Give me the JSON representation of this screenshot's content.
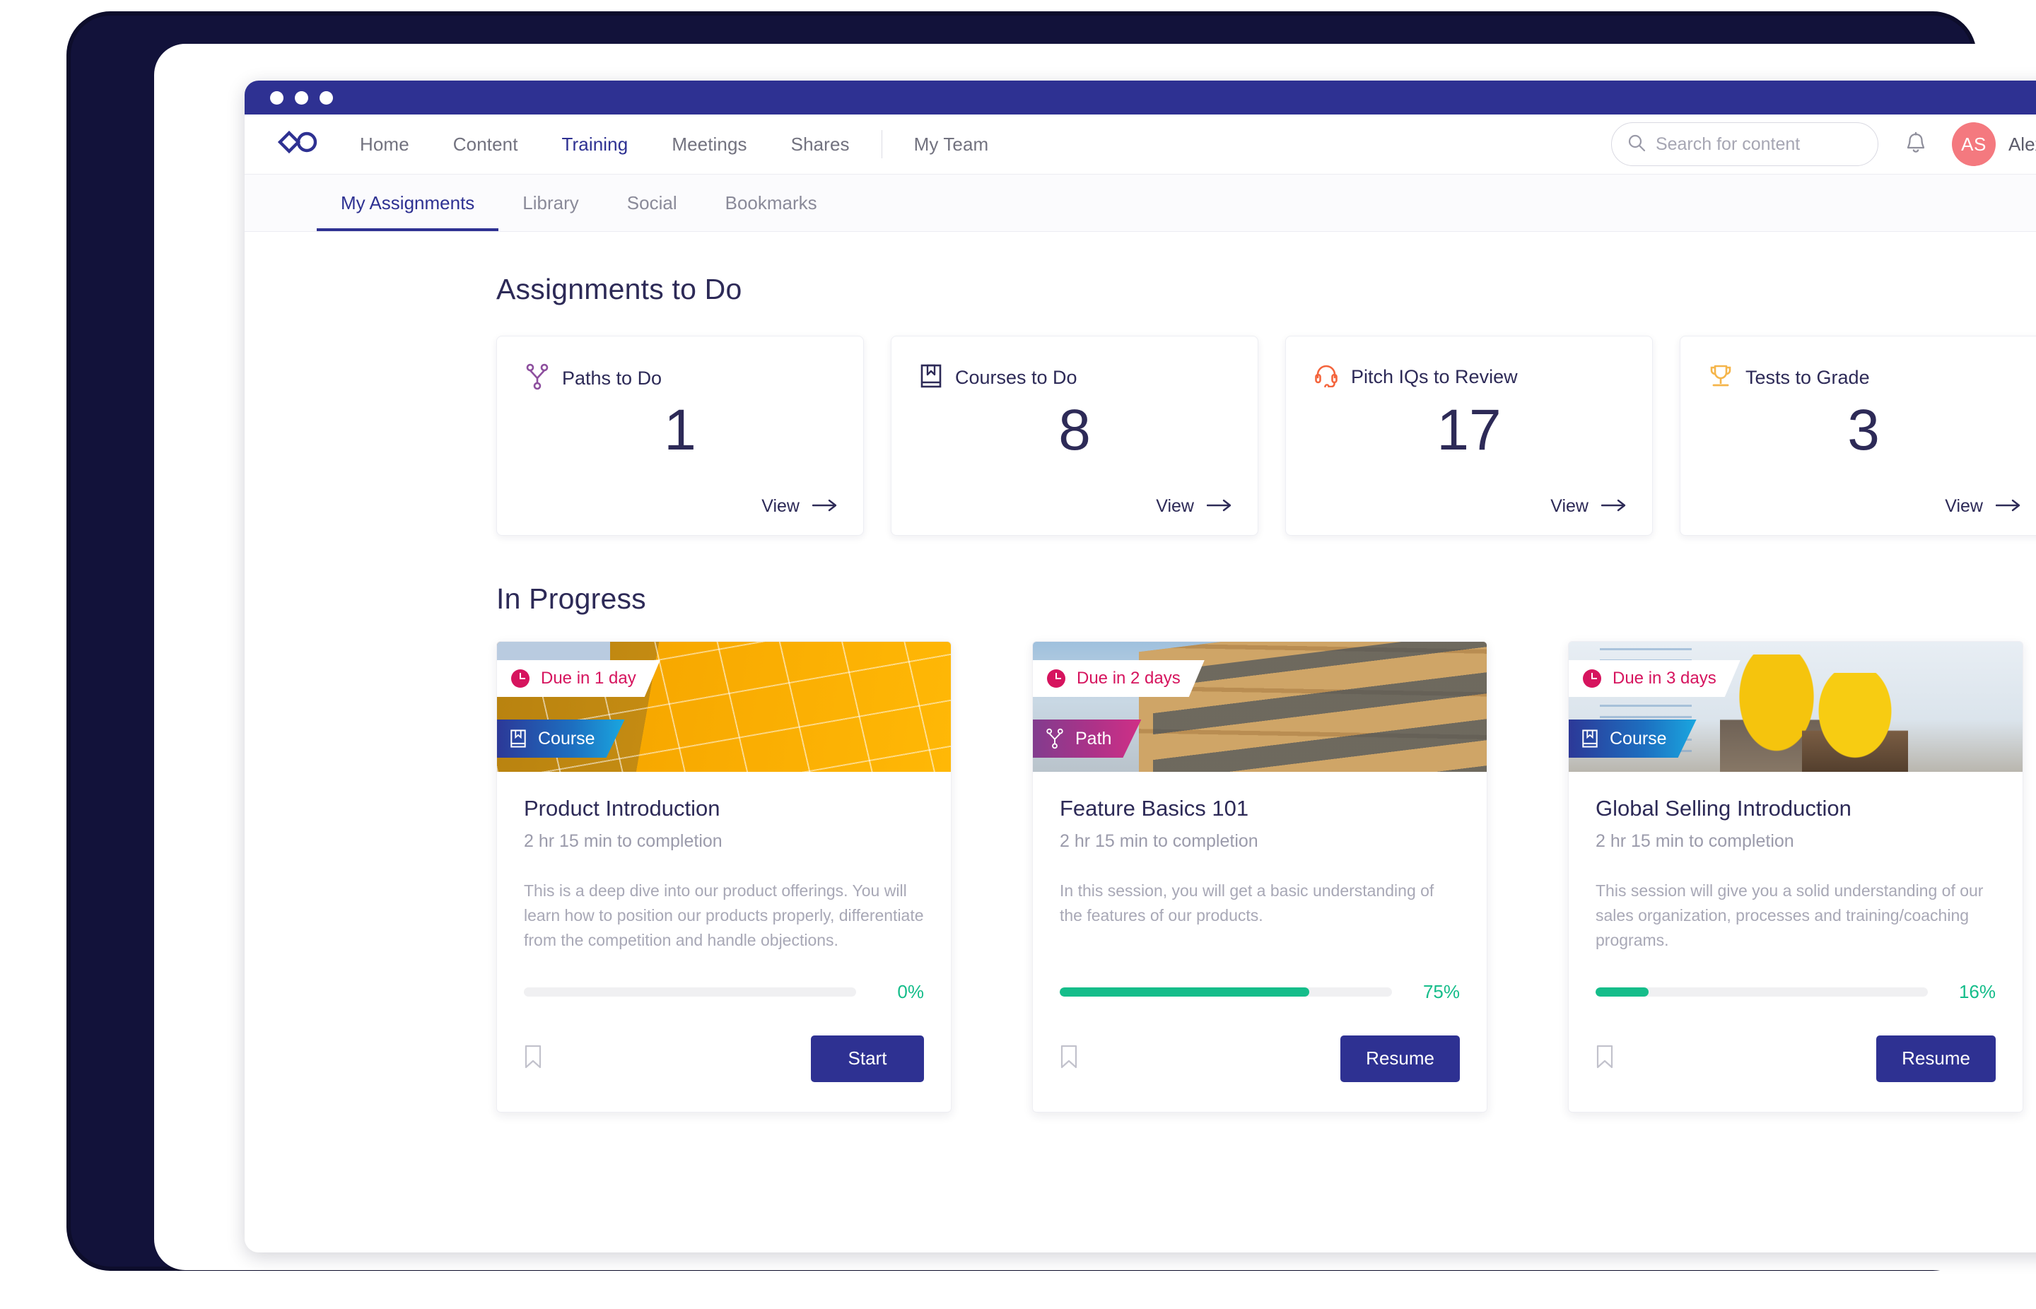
{
  "window": {
    "dots": 3
  },
  "topnav": {
    "logo_icon": "infinity-logo",
    "links": [
      {
        "label": "Home",
        "active": false
      },
      {
        "label": "Content",
        "active": false
      },
      {
        "label": "Training",
        "active": true
      },
      {
        "label": "Meetings",
        "active": false
      },
      {
        "label": "Shares",
        "active": false
      },
      {
        "label": "My Team",
        "active": false
      }
    ],
    "search": {
      "placeholder": "Search for content",
      "value": "",
      "icon": "search-icon"
    },
    "bell_icon": "bell-icon",
    "avatar_initials": "AS",
    "username": "Alexa"
  },
  "subnav": {
    "tabs": [
      {
        "label": "My Assignments",
        "active": true
      },
      {
        "label": "Library",
        "active": false
      },
      {
        "label": "Social",
        "active": false
      },
      {
        "label": "Bookmarks",
        "active": false
      }
    ]
  },
  "assignments": {
    "heading": "Assignments to Do",
    "view_label": "View",
    "cards": [
      {
        "label": "Paths to Do",
        "count": "1",
        "icon": "path-branch-icon",
        "icon_color": "#8d4f9e"
      },
      {
        "label": "Courses to Do",
        "count": "8",
        "icon": "book-icon",
        "icon_color": "#2d2a57"
      },
      {
        "label": "Pitch IQs to Review",
        "count": "17",
        "icon": "headset-icon",
        "icon_color": "#f4643c"
      },
      {
        "label": "Tests to Grade",
        "count": "3",
        "icon": "trophy-icon",
        "icon_color": "#f5b54a"
      }
    ]
  },
  "in_progress": {
    "heading": "In Progress",
    "cards": [
      {
        "due_label": "Due in 1 day",
        "type_label": "Course",
        "type_icon": "book-icon",
        "title": "Product Introduction",
        "meta": "2 hr 15 min to completion",
        "description": "This is a deep dive into our product offerings. You will learn how to position our products properly, differentiate from the competition and handle objections.",
        "progress_pct": 0,
        "progress_label": "0%",
        "button_label": "Start",
        "bookmark_icon": "bookmark-icon",
        "image_alt": "yellow-glass-building"
      },
      {
        "due_label": "Due in 2 days",
        "type_label": "Path",
        "type_icon": "path-branch-icon",
        "title": "Feature Basics 101",
        "meta": "2 hr 15 min to completion",
        "description": "In this session, you will get a basic understanding of the features of our products.",
        "progress_pct": 75,
        "progress_label": "75%",
        "button_label": "Resume",
        "bookmark_icon": "bookmark-icon",
        "image_alt": "brick-office-building"
      },
      {
        "due_label": "Due in 3 days",
        "type_label": "Course",
        "type_icon": "book-icon",
        "title": "Global Selling Introduction",
        "meta": "2 hr 15 min to completion",
        "description": "This session will give you a solid understanding of our sales organization, processes and training/coaching programs.",
        "progress_pct": 16,
        "progress_label": "16%",
        "button_label": "Resume",
        "bookmark_icon": "bookmark-icon",
        "image_alt": "two-workers-in-hard-hats"
      }
    ]
  },
  "colors": {
    "brand_navy": "#2e3192",
    "heading": "#2d2a57",
    "due_crimson": "#d6145e",
    "progress_green": "#15bd8a",
    "avatar_coral": "#f4797f"
  }
}
